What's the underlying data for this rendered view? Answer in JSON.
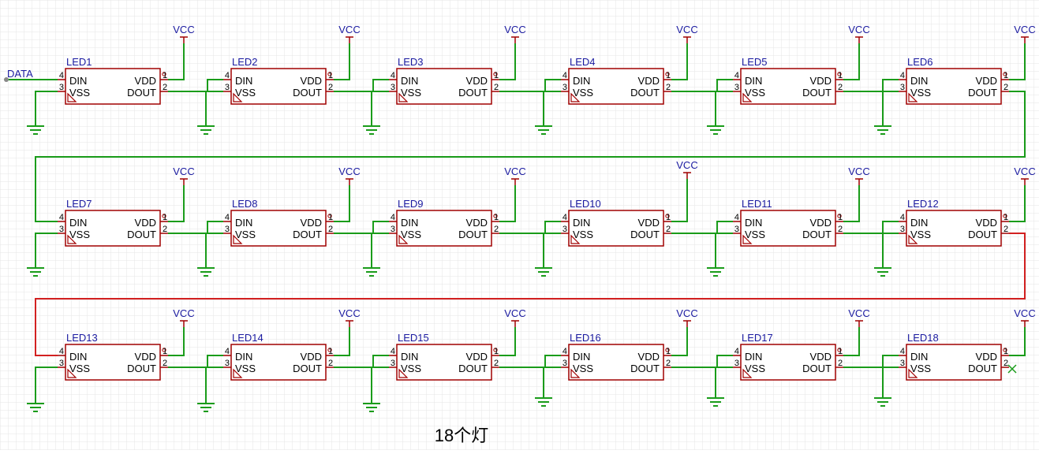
{
  "caption": "18个灯",
  "net_labels": {
    "data": "DATA",
    "vcc": "VCC"
  },
  "pins": {
    "din": "DIN",
    "vss": "VSS",
    "vdd": "VDD",
    "dout": "DOUT",
    "din_num": "4",
    "vss_num": "3",
    "vdd_num": "1",
    "dout_num": "2"
  },
  "leds": [
    "LED1",
    "LED2",
    "LED3",
    "LED4",
    "LED5",
    "LED6",
    "LED7",
    "LED8",
    "LED9",
    "LED10",
    "LED11",
    "LED12",
    "LED13",
    "LED14",
    "LED15",
    "LED16",
    "LED17",
    "LED18"
  ],
  "colors": {
    "wire": "#1a9c1a",
    "body": "#a00000",
    "net": "#1a1aa0",
    "chain_wire_row2": "#d22020"
  }
}
